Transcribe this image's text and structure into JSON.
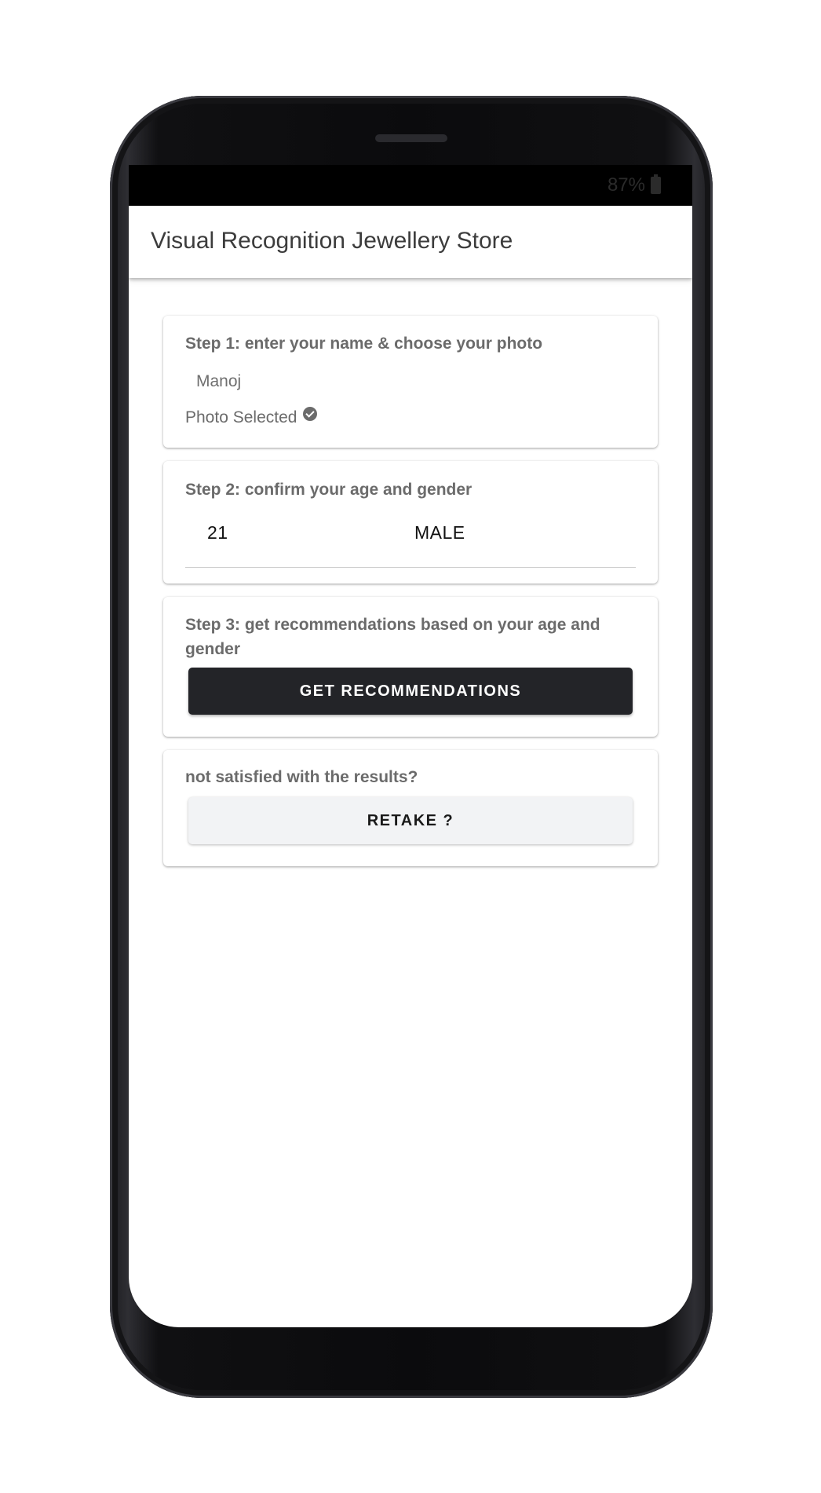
{
  "status_bar": {
    "battery_text": "87%"
  },
  "app_bar": {
    "title": "Visual Recognition Jewellery Store"
  },
  "step1": {
    "label": "Step 1: enter your name & choose your photo",
    "name_value": "Manoj",
    "photo_status": "Photo Selected"
  },
  "step2": {
    "label": "Step 2: confirm your age and gender",
    "age_value": "21",
    "gender_value": "MALE"
  },
  "step3": {
    "label_line1": "Step 3: get recommendations based on your age and",
    "label_line2": "gender",
    "button_label": "GET RECOMMENDATIONS"
  },
  "retake": {
    "label": "not satisfied with the results?",
    "button_label": "RETAKE ?"
  },
  "colors": {
    "primary_button": "#232428",
    "secondary_button": "#f2f3f5",
    "text_muted": "#6b6b6b"
  },
  "icons": {
    "photo_status": "check-circle-icon",
    "battery": "battery-icon"
  }
}
